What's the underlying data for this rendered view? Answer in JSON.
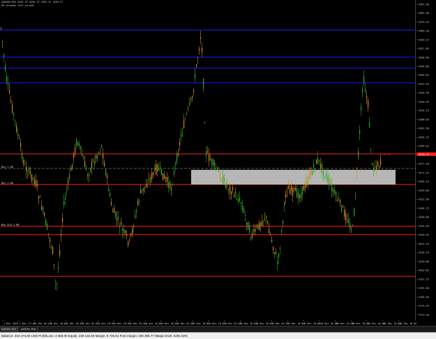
{
  "chart": {
    "colors": {
      "background": "#000000",
      "bull_candle": "#2fa82f",
      "bear_candle": "#d98a1e",
      "resistance_lines": "#1a1aff",
      "support_lines": "#ff2020",
      "zone_fill": "#c0c0c0",
      "dashed_level": "#aaaaaa",
      "last_price_box": "#ff2020"
    },
    "info_lines": [
      "XAUUSD,M15  4292.57 4294.37 4292.57 4294.37",
      "50 seconds left to end"
    ],
    "price_labels": [
      "4387.90",
      "4381.00",
      "4375.45",
      "4369.30",
      "4363.15",
      "4357.05",
      "4350.90",
      "4344.80",
      "4338.65",
      "4332.55",
      "4326.40",
      "4320.30",
      "4314.15",
      "4308.05",
      "4301.90",
      "4295.75",
      "4289.65",
      "4283.50",
      "4277.40",
      "4271.25",
      "4265.15",
      "4259.00",
      "4252.90",
      "4246.75",
      "4240.60",
      "4234.50",
      "4228.35",
      "4222.25",
      "4216.10",
      "4210.00",
      "4203.85",
      "4197.75",
      "4191.60",
      "4185.50",
      "4179.35",
      "4173.20"
    ],
    "price_highlight": {
      "text": "4294.37"
    },
    "line_tags": [
      {
        "text": "Buy_1.00"
      },
      {
        "text": "Buy_1.00"
      },
      {
        "text": "Buy_SL4_1.00"
      },
      {
        "text": "100.00"
      }
    ],
    "time_labels": [
      "1 Dec 2025",
      "1 Dec 17:00",
      "2 Dec 02:00",
      "2 Dec 10:00",
      "2 Dec 18:00",
      "3 Dec 02:00",
      "3 Dec 10:00",
      "3 Dec 18:00",
      "4 Dec 02:00",
      "4 Dec 10:00",
      "4 Dec 18:00",
      "5 Dec 02:00",
      "5 Dec 10:00",
      "5 Dec 18:00",
      "8 Dec 02:00",
      "8 Dec 10:00",
      "8 Dec 18:00",
      "9 Dec 02:00",
      "9 Dec 10:00",
      "9 Dec 18:00",
      "10 Dec 02:00",
      "10 Dec 10:00",
      "10 Dec 18:00",
      "11 Dec 02:00",
      "11 Dec 10:00",
      "11 Dec 18:00"
    ]
  },
  "tabs": [
    "XAUUSD,M15",
    "AUDUSD,M30"
  ],
  "status": {
    "text": "Balance: 234 473.60 USD  Profit/Loss: 4 658.00  Equity: 239 132.60  Margin: 8 726.61  Free margin: 230 395.77  Margin level: 6291.82%"
  }
}
